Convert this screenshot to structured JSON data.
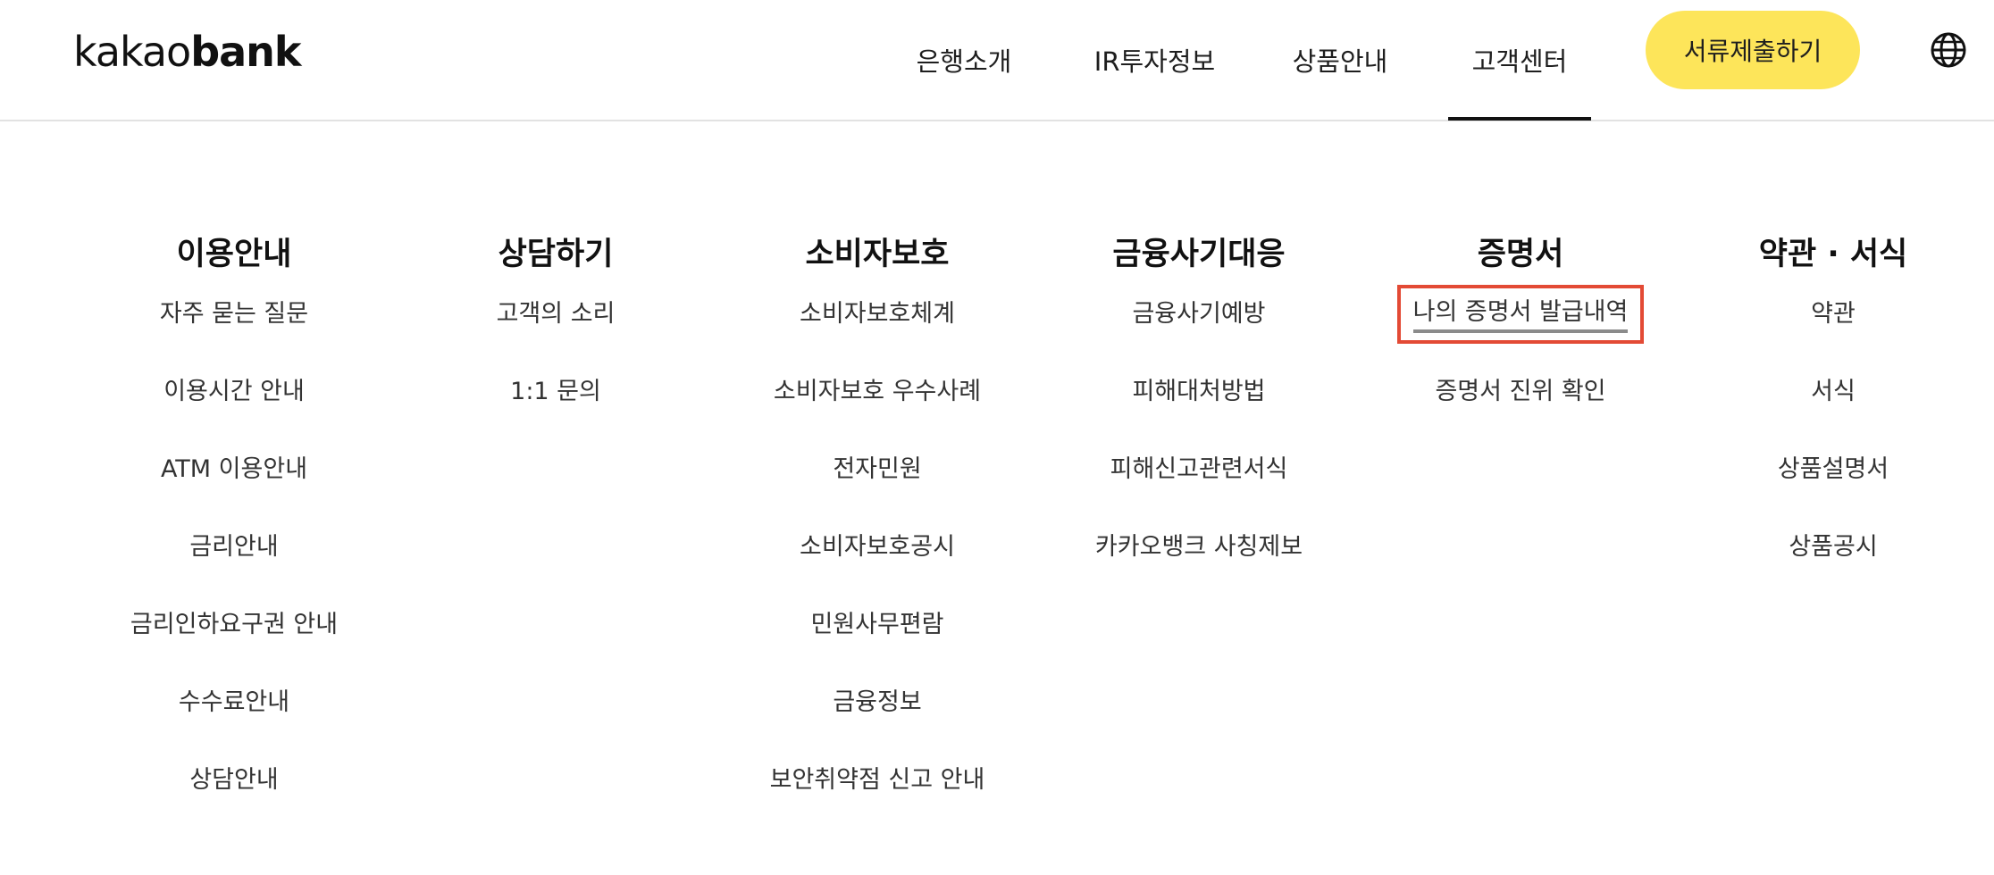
{
  "header": {
    "logo": {
      "light": "kakao",
      "bold": "bank"
    },
    "nav": [
      {
        "label": "은행소개"
      },
      {
        "label": "IR투자정보"
      },
      {
        "label": "상품안내"
      },
      {
        "label": "고객센터",
        "active": true
      }
    ],
    "cta_label": "서류제출하기",
    "language_icon": "globe-icon"
  },
  "menu": {
    "columns": [
      {
        "title": "이용안내",
        "links": [
          "자주 묻는 질문",
          "이용시간 안내",
          "ATM 이용안내",
          "금리안내",
          "금리인하요구권 안내",
          "수수료안내",
          "상담안내"
        ]
      },
      {
        "title": "상담하기",
        "links": [
          "고객의 소리",
          "1:1 문의"
        ]
      },
      {
        "title": "소비자보호",
        "links": [
          "소비자보호체계",
          "소비자보호 우수사례",
          "전자민원",
          "소비자보호공시",
          "민원사무편람",
          "금융정보",
          "보안취약점 신고 안내"
        ]
      },
      {
        "title": "금융사기대응",
        "links": [
          "금융사기예방",
          "피해대처방법",
          "피해신고관련서식",
          "카카오뱅크 사칭제보"
        ]
      },
      {
        "title": "증명서",
        "links": [
          "나의 증명서 발급내역",
          "증명서 진위 확인"
        ]
      },
      {
        "title": "약관 · 서식",
        "links": [
          "약관",
          "서식",
          "상품설명서",
          "상품공시"
        ]
      }
    ]
  },
  "colors": {
    "accent_yellow": "#fde55a",
    "highlight_red": "#e34a35",
    "text": "#1e1e1e"
  }
}
